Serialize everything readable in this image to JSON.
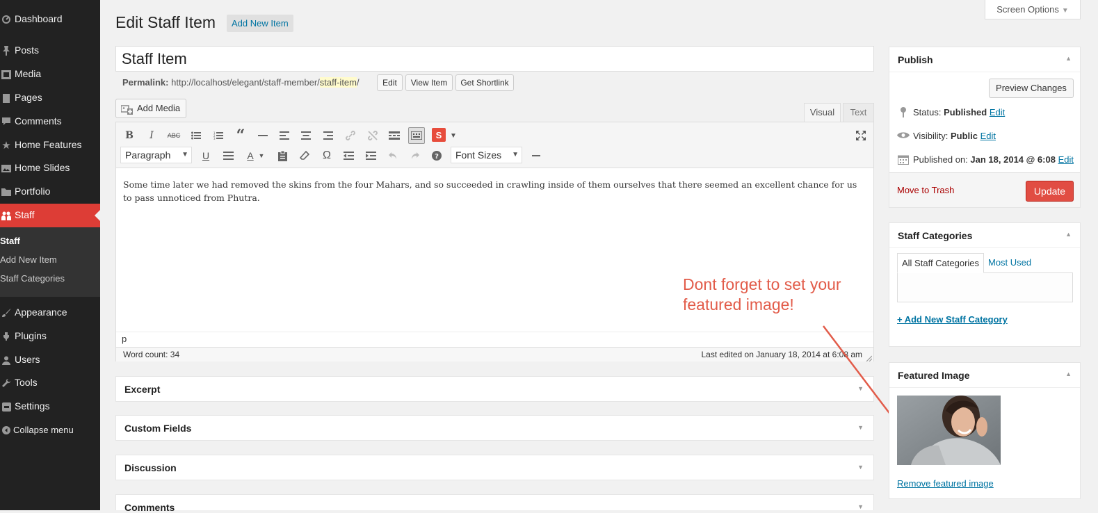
{
  "colors": {
    "sidebar_bg": "#222222",
    "accent": "#dd3d36",
    "link": "#0074a2",
    "update_button": "#e14d43",
    "annotation": "#e25c4a"
  },
  "sidebar": {
    "items": [
      {
        "label": "Dashboard",
        "icon": "dashboard-icon"
      },
      {
        "label": "Posts",
        "icon": "pushpin-icon"
      },
      {
        "label": "Media",
        "icon": "media-icon"
      },
      {
        "label": "Pages",
        "icon": "page-icon"
      },
      {
        "label": "Comments",
        "icon": "comment-icon"
      },
      {
        "label": "Home Features",
        "icon": "star-icon"
      },
      {
        "label": "Home Slides",
        "icon": "slides-icon"
      },
      {
        "label": "Portfolio",
        "icon": "folder-icon"
      },
      {
        "label": "Staff",
        "icon": "staff-icon",
        "current": true
      }
    ],
    "submenu": [
      "Staff",
      "Add New Item",
      "Staff Categories"
    ],
    "lower_items": [
      {
        "label": "Appearance",
        "icon": "brush-icon"
      },
      {
        "label": "Plugins",
        "icon": "plugin-icon"
      },
      {
        "label": "Users",
        "icon": "users-icon"
      },
      {
        "label": "Tools",
        "icon": "wrench-icon"
      },
      {
        "label": "Settings",
        "icon": "settings-icon"
      }
    ],
    "collapse_label": "Collapse menu"
  },
  "header": {
    "title": "Edit Staff Item",
    "add_new_label": "Add New Item",
    "screen_options_label": "Screen Options"
  },
  "post": {
    "title": "Staff Item",
    "permalink_label": "Permalink:",
    "permalink_base": "http://localhost/elegant/staff-member/",
    "permalink_slug": "staff-item",
    "permalink_trail": "/",
    "edit_label": "Edit",
    "view_label": "View Item",
    "shortlink_label": "Get Shortlink"
  },
  "editor": {
    "add_media_label": "Add Media",
    "tab_visual": "Visual",
    "tab_text": "Text",
    "format_select": "Paragraph",
    "font_size_select": "Font Sizes",
    "content": "Some time later we had removed the skins from the four Mahars, and so succeeded in crawling inside of them ourselves that there seemed an excellent chance for us to pass unnoticed from Phutra.",
    "path": "p",
    "word_count": "Word count: 34",
    "last_edited": "Last edited on January 18, 2014 at 6:08 am",
    "plugin_badge": "S"
  },
  "postboxes": [
    "Excerpt",
    "Custom Fields",
    "Discussion",
    "Comments"
  ],
  "annotation": "Dont forget to set your featured image!",
  "publish": {
    "title": "Publish",
    "preview_label": "Preview Changes",
    "status_label": "Status:",
    "status_value": "Published",
    "visibility_label": "Visibility:",
    "visibility_value": "Public",
    "published_label": "Published on:",
    "published_value": "Jan 18, 2014 @ 6:08",
    "edit_label": "Edit",
    "trash_label": "Move to Trash",
    "update_label": "Update"
  },
  "categories": {
    "title": "Staff Categories",
    "tab_all": "All Staff Categories",
    "tab_most_used": "Most Used",
    "add_link": "+ Add New Staff Category"
  },
  "featured": {
    "title": "Featured Image",
    "remove_link": "Remove featured image"
  }
}
